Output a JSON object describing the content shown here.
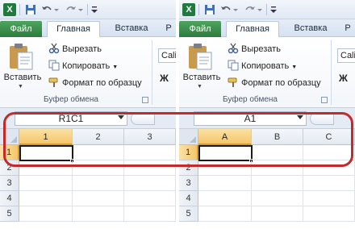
{
  "colors": {
    "file_tab": "#2c7c3d",
    "highlight": "#c42a2a",
    "selected_header": "#f5c66a"
  },
  "icons": [
    "excel-icon",
    "save-icon",
    "undo-icon",
    "redo-icon",
    "customize-icon",
    "paste-icon",
    "cut-icon",
    "copy-icon",
    "format-painter-icon"
  ],
  "left": {
    "tabs": {
      "file": "Файл",
      "home": "Главная",
      "insert": "Вставка",
      "overflow": "Р"
    },
    "ribbon": {
      "paste": "Вставить",
      "cut": "Вырезать",
      "copy": "Копировать",
      "format_painter": "Формат по образцу",
      "group": "Буфер обмена",
      "font": "Cali",
      "bold": "Ж"
    },
    "namebox": "R1C1",
    "columns": [
      "1",
      "2",
      "3"
    ],
    "rows": [
      "1",
      "2",
      "3",
      "4",
      "5"
    ]
  },
  "right": {
    "tabs": {
      "file": "Файл",
      "home": "Главная",
      "insert": "Вставка",
      "overflow": "Р"
    },
    "ribbon": {
      "paste": "Вставить",
      "cut": "Вырезать",
      "copy": "Копировать",
      "format_painter": "Формат по образцу",
      "group": "Буфер обмена",
      "font": "Cali",
      "bold": "Ж"
    },
    "namebox": "A1",
    "columns": [
      "A",
      "B",
      "C"
    ],
    "rows": [
      "1",
      "2",
      "3",
      "4",
      "5"
    ]
  }
}
